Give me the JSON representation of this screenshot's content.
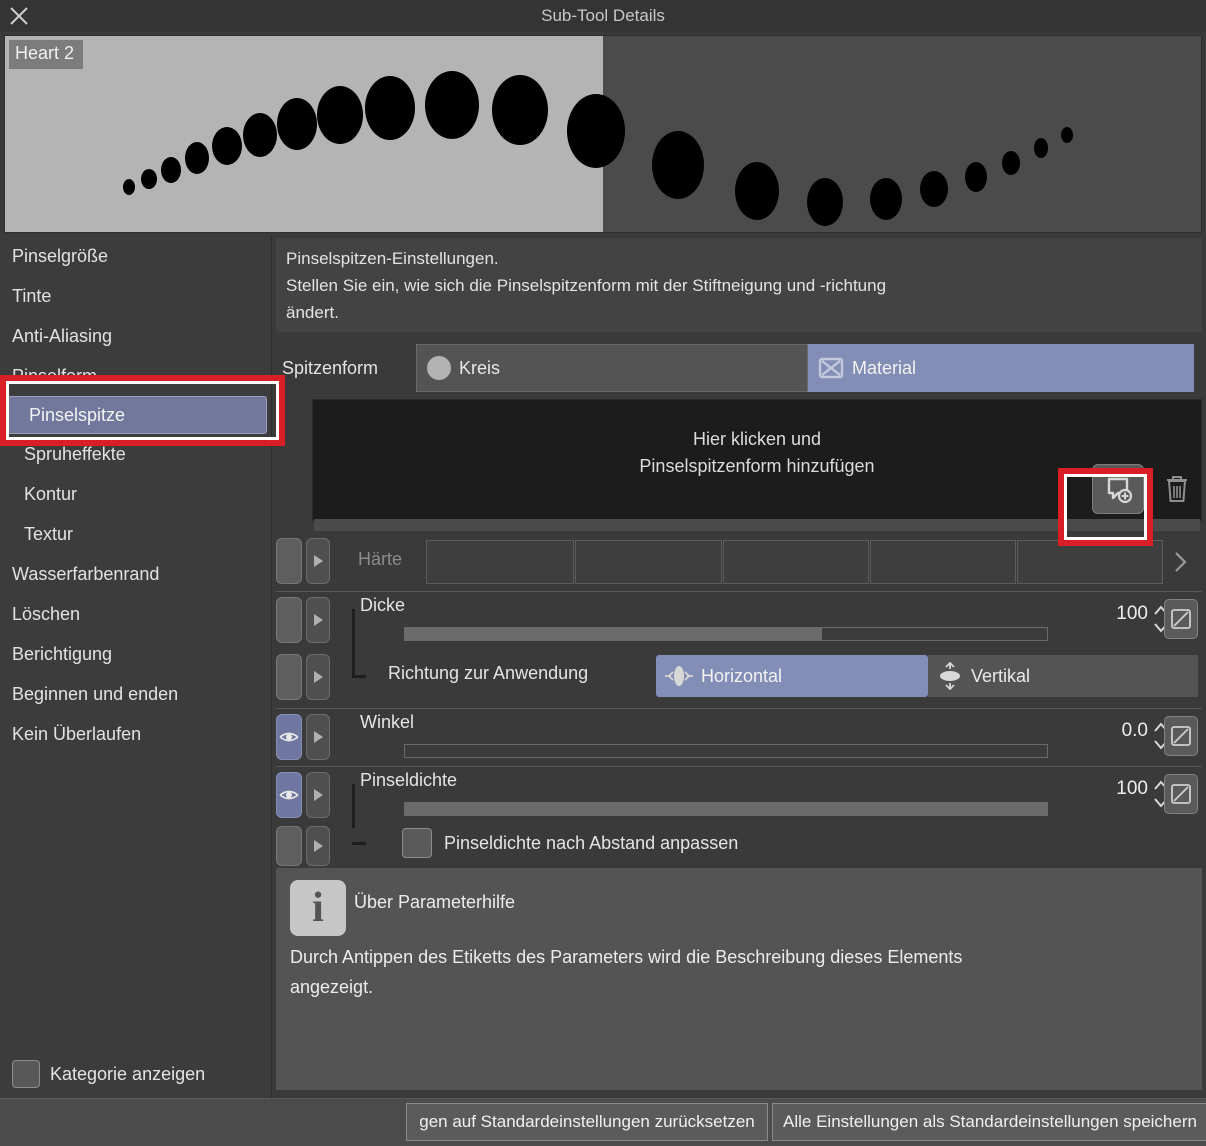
{
  "window": {
    "title": "Sub-Tool Details",
    "close_icon": "close-icon"
  },
  "preview": {
    "brush_name": "Heart 2",
    "light_bg": "#b4b4b4",
    "dark_bg": "#4b4b4b",
    "dot_color": "#000000"
  },
  "sidebar": {
    "items": [
      {
        "label": "Pinselgröße",
        "sub": false,
        "selected": false
      },
      {
        "label": "Tinte",
        "sub": false,
        "selected": false
      },
      {
        "label": "Anti-Aliasing",
        "sub": false,
        "selected": false
      },
      {
        "label": "Pinselform",
        "sub": false,
        "selected": false
      },
      {
        "label": "Pinselspitze",
        "sub": true,
        "selected": true
      },
      {
        "label": "Spruheffekte",
        "sub": true,
        "selected": false
      },
      {
        "label": "Kontur",
        "sub": true,
        "selected": false
      },
      {
        "label": "Textur",
        "sub": true,
        "selected": false
      },
      {
        "label": "Wasserfarbenrand",
        "sub": false,
        "selected": false
      },
      {
        "label": "Löschen",
        "sub": false,
        "selected": false
      },
      {
        "label": "Berichtigung",
        "sub": false,
        "selected": false
      },
      {
        "label": "Beginnen und enden",
        "sub": false,
        "selected": false
      },
      {
        "label": "Kein Überlaufen",
        "sub": false,
        "selected": false
      }
    ],
    "show_category": {
      "label": "Kategorie anzeigen",
      "checked": false
    }
  },
  "description": {
    "line1": "Pinselspitzen-Einstellungen.",
    "line2": "Stellen Sie ein, wie sich die Pinselspitzenform mit der Stiftneigung und -richtung",
    "line3": "ändert."
  },
  "tip_shape": {
    "caption": "Spitzenform",
    "options": [
      {
        "label": "Kreis",
        "icon": "circle-icon",
        "selected": false
      },
      {
        "label": "Material",
        "icon": "material-placeholder-icon",
        "selected": true
      }
    ]
  },
  "material_area": {
    "hint_line1": "Hier klicken und",
    "hint_line2": "Pinselspitzenform hinzufügen",
    "add_button_icon": "add-material-icon",
    "delete_button_icon": "trash-icon"
  },
  "parameters": [
    {
      "name": "haerte",
      "label": "Härte",
      "label_dim": true,
      "type": "swatches",
      "toggle": "off",
      "swatch_count": 5,
      "more_icon": "chevron-right-icon"
    },
    {
      "name": "dicke",
      "label": "Dicke",
      "type": "slider",
      "toggle": "off",
      "value": "100",
      "fill_percent": 65,
      "reset_icon": "reset-icon"
    },
    {
      "name": "richtung-zur-anwendung",
      "label": "Richtung zur Anwendung",
      "type": "segmented",
      "toggle": "off",
      "options": [
        {
          "label": "Horizontal",
          "icon": "horizontal-arrows-icon",
          "selected": true
        },
        {
          "label": "Vertikal",
          "icon": "vertical-arrows-icon",
          "selected": false
        }
      ]
    },
    {
      "name": "winkel",
      "label": "Winkel",
      "type": "slider",
      "toggle": "eye",
      "value": "0.0",
      "fill_percent": 0,
      "reset_icon": "reset-icon"
    },
    {
      "name": "pinseldichte",
      "label": "Pinseldichte",
      "type": "slider",
      "toggle": "eye",
      "value": "100",
      "fill_percent": 100,
      "reset_icon": "reset-icon"
    },
    {
      "name": "pinseldichte-nach-abstand-anpassen",
      "label": "Pinseldichte nach Abstand anpassen",
      "type": "checkbox",
      "toggle": "off",
      "checked": false
    }
  ],
  "info_panel": {
    "icon": "info-icon",
    "icon_glyph": "i",
    "title": "Über Parameterhilfe",
    "body_line1": "Durch Antippen des Etiketts des Parameters wird die Beschreibung dieses Elements",
    "body_line2": "angezeigt."
  },
  "footer": {
    "reset_button": "gen auf Standardeinstellungen zurücksetzen",
    "save_button": "Alle Einstellungen als Standardeinstellungen speichern"
  },
  "highlights": {
    "color": "#d81f26",
    "targets": [
      "sidebar-item-pinselspitze",
      "add-material-button"
    ]
  }
}
